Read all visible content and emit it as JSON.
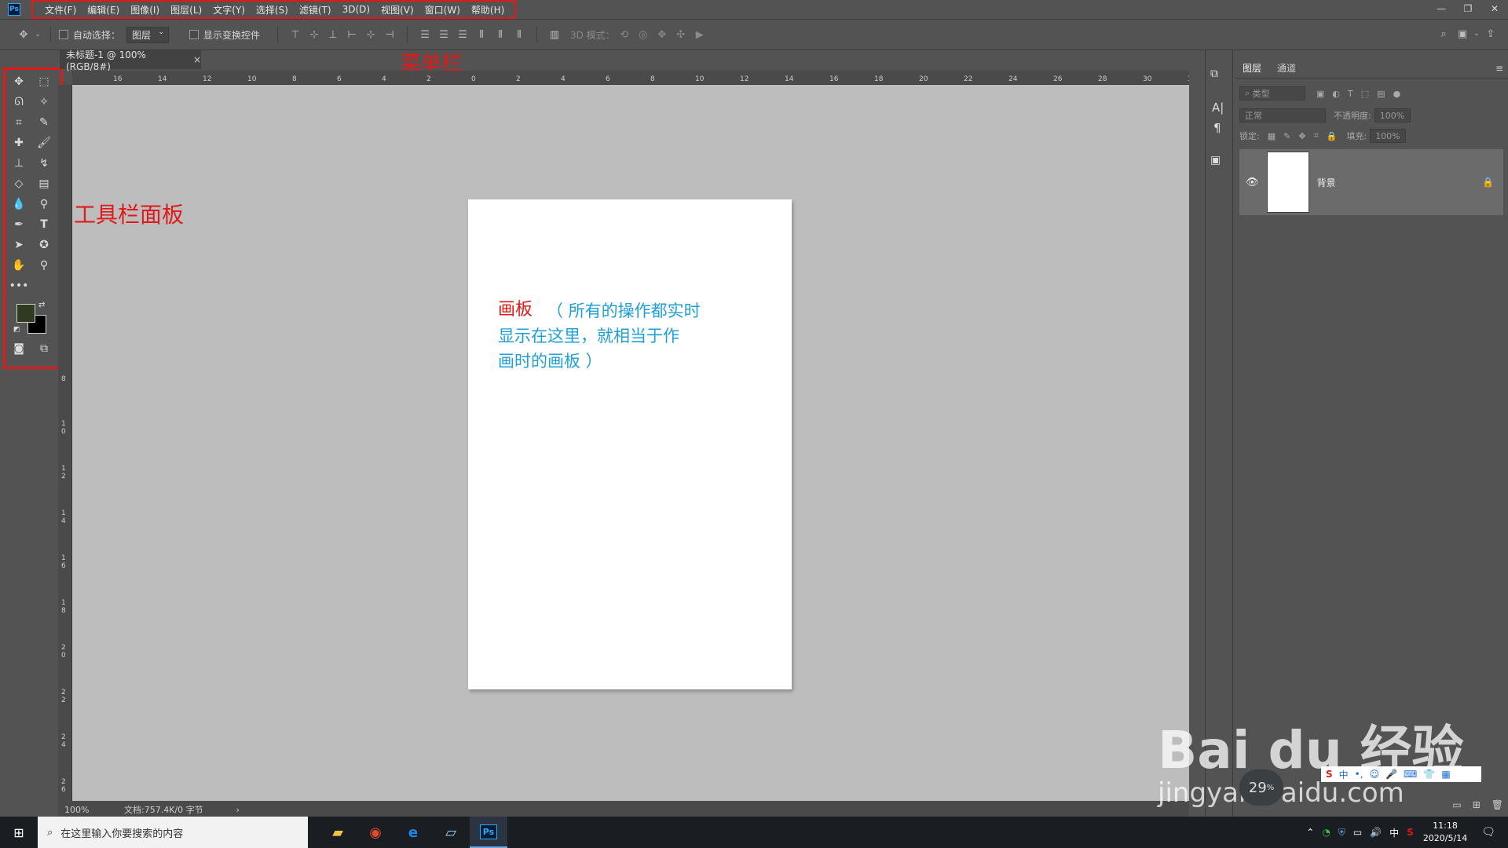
{
  "menubar": {
    "logo": "Ps",
    "items": [
      "文件(F)",
      "编辑(E)",
      "图像(I)",
      "图层(L)",
      "文字(Y)",
      "选择(S)",
      "滤镜(T)",
      "3D(D)",
      "视图(V)",
      "窗口(W)",
      "帮助(H)"
    ]
  },
  "window_controls": {
    "minimize": "—",
    "restore": "❐",
    "close": "✕"
  },
  "options": {
    "auto_select_label": "自动选择：",
    "auto_select_value": "图层",
    "show_transform_label": "显示变换控件",
    "mode_3d_label": "3D 模式："
  },
  "document": {
    "tab_title": "未标题-1 @ 100%(RGB/8#)",
    "tab_close": "×",
    "zoom": "100%",
    "doc_info": "文档:757.4K/0 字节",
    "status_arrow": "›"
  },
  "ruler": {
    "h_ticks": [
      "16",
      "14",
      "12",
      "10",
      "8",
      "6",
      "4",
      "2",
      "0",
      "2",
      "4",
      "6",
      "8",
      "10",
      "12",
      "14",
      "16",
      "18",
      "20",
      "22",
      "24",
      "26",
      "28",
      "30",
      "3"
    ],
    "v_ticks": [
      "8",
      "1 0",
      "1 2",
      "1 4",
      "1 6",
      "1 8",
      "2 0",
      "2 2",
      "2 4",
      "2 6"
    ]
  },
  "annotations": {
    "menubar_label": "菜单栏",
    "toolbar_label": "工具栏面板",
    "artboard_title": "画板",
    "artboard_desc_1": "（ 所有的操作都实时",
    "artboard_desc_2": "显示在这里，就相当于作",
    "artboard_desc_3": "画时的画板 ）"
  },
  "layers_panel": {
    "tabs": [
      "图层",
      "通道"
    ],
    "filter_label": "类型",
    "blend_mode": "正常",
    "opacity_label": "不透明度:",
    "opacity_value": "100%",
    "lock_label": "锁定:",
    "fill_label": "填充:",
    "fill_value": "100%",
    "layer_name": "背景"
  },
  "watermark": {
    "brand": "Bai du 经验",
    "url": "jingyan.baidu.com"
  },
  "widget": {
    "temp": "29",
    "unit": "%",
    "ime": "中"
  },
  "taskbar": {
    "search_placeholder": "在这里输入你要搜索的内容",
    "time": "11:18",
    "date": "2020/5/14",
    "ime": "中"
  },
  "colors": {
    "accent_red": "#e01919",
    "annotation_blue": "#1e9fd8",
    "panel_bg": "#535353",
    "canvas_bg": "#bdbdbd",
    "foreground_swatch": "#2f3a1e"
  }
}
